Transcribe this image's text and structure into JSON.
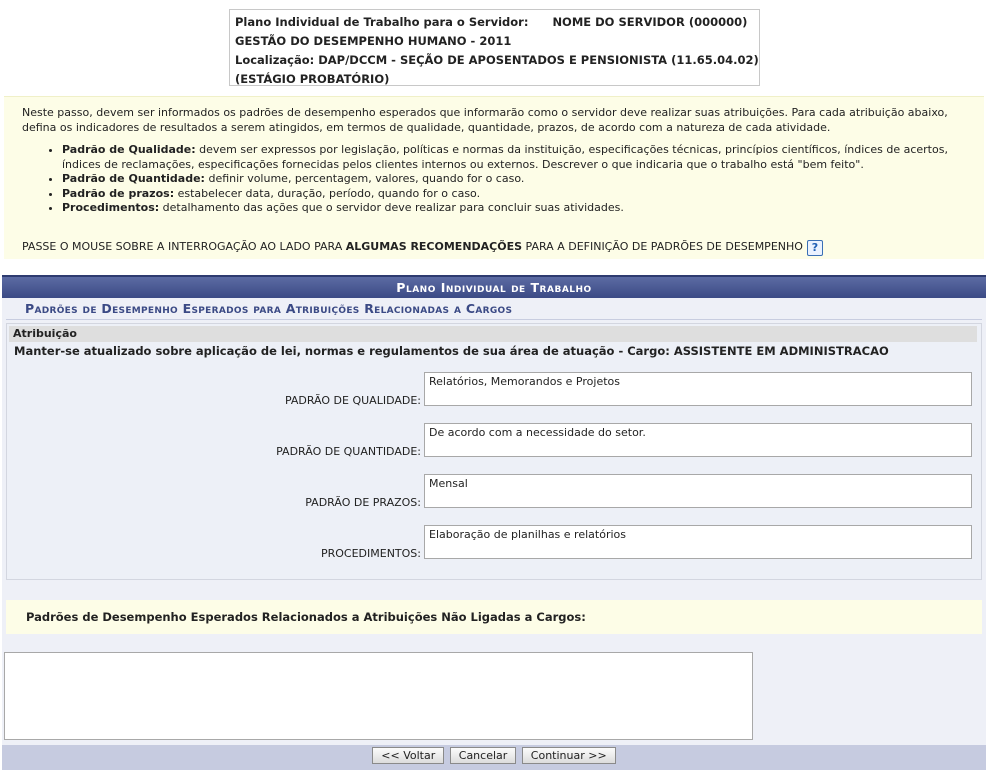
{
  "identificacao": {
    "servidor_label": "Plano Individual de Trabalho para o Servidor:",
    "servidor_nome": "NOME DO SERVIDOR (000000)",
    "programa": "GESTÃO DO DESEMPENHO HUMANO - 2011",
    "localizacao": "Localização: DAP/DCCM - SEÇÃO DE APOSENTADOS E PENSIONISTA (11.65.04.02)",
    "status": "(ESTÁGIO PROBATÓRIO)"
  },
  "instrucoes": {
    "intro": "Neste passo, devem ser informados os padrões de desempenho esperados que informarão como o servidor deve realizar suas atribuições. Para cada atribuição abaixo, defina os indicadores de resultados a serem atingidos, em termos de qualidade, quantidade, prazos, de acordo com a natureza de cada atividade.",
    "itens": [
      {
        "termo": "Padrão de Qualidade:",
        "descricao": " devem ser expressos por legislação, políticas e normas da instituição, especificações técnicas, princípios científicos, índices de acertos, índices de reclamações, especificações fornecidas pelos clientes internos ou externos. Descrever o que indicaria que o trabalho está \"bem feito\"."
      },
      {
        "termo": "Padrão de Quantidade:",
        "descricao": " definir volume, percentagem, valores, quando for o caso."
      },
      {
        "termo": "Padrão de prazos:",
        "descricao": " estabelecer data, duração, período, quando for o caso."
      },
      {
        "termo": "Procedimentos:",
        "descricao": " detalhamento das ações que o servidor deve realizar para concluir suas atividades."
      }
    ],
    "dica_pre": "Passe o mouse sobre a interrogação ao lado para ",
    "dica_destaque": "algumas recomendações",
    "dica_pos": " para a definição de padrões de desempenho",
    "help_icon_glyph": "?"
  },
  "formulario": {
    "caption": "Plano Individual de Trabalho",
    "subtitulo": "Padrões de Desempenho Esperados para Atribuições Relacionadas a Cargos",
    "atribuicao_header": "Atribuição",
    "atribuicao_texto": "Manter-se atualizado sobre aplicação de lei, normas e regulamentos de sua área de atuação - Cargo: ASSISTENTE EM ADMINISTRACAO",
    "campos": [
      {
        "label": "PADRÃO DE QUALIDADE:",
        "valor": "Relatórios, Memorandos e Projetos"
      },
      {
        "label": "PADRÃO DE QUANTIDADE:",
        "valor": "De acordo com a necessidade do setor."
      },
      {
        "label": "PADRÃO DE PRAZOS:",
        "valor": "Mensal"
      },
      {
        "label": "PROCEDIMENTOS:",
        "valor": "Elaboração de planilhas e relatórios"
      }
    ],
    "nao_ligadas_label": "Padrões de Desempenho Esperados Relacionados a Atribuições Não Ligadas a Cargos:",
    "nao_ligadas_valor": ""
  },
  "botoes": {
    "voltar": "<< Voltar",
    "cancelar": "Cancelar",
    "continuar": "Continuar >>"
  },
  "cores": {
    "caption_bg": "#3b4a85",
    "instructions_bg": "#fdfde7",
    "form_bg": "#eef0f7"
  }
}
